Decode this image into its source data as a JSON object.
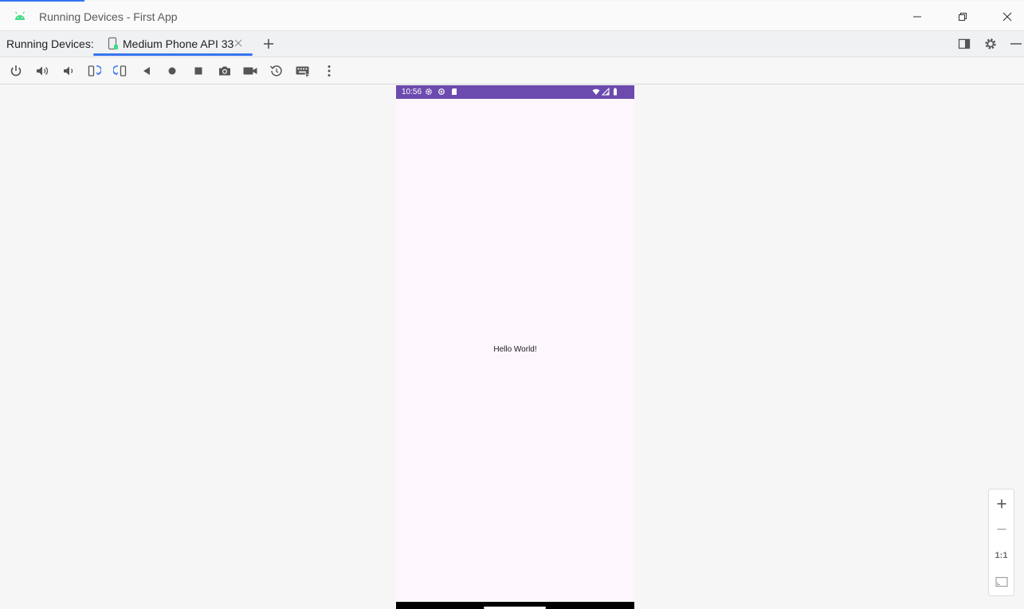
{
  "window": {
    "title": "Running Devices - First App",
    "controls": [
      "minimize-icon",
      "restore-icon",
      "close-icon"
    ]
  },
  "tabbar": {
    "label": "Running Devices:",
    "tabs": [
      {
        "label": "Medium Phone API 33",
        "icon": "device-icon",
        "active": true
      }
    ],
    "add_icon": "plus-icon",
    "right_icons": [
      "layout-icon",
      "gear-icon",
      "minimize-panel-icon"
    ]
  },
  "toolbar": {
    "icons": [
      "power-icon",
      "volume-up-icon",
      "volume-down-icon",
      "rotate-left-icon",
      "rotate-right-icon",
      "back-icon",
      "home-icon",
      "overview-icon",
      "screenshot-icon",
      "screen-record-icon",
      "snapshot-icon",
      "virtual-keyboard-icon",
      "more-options-icon"
    ]
  },
  "device": {
    "status_bar": {
      "time": "10:56",
      "left_icons": [
        "settings-icon",
        "location-icon",
        "sd-card-icon"
      ],
      "right_icons": [
        "wifi-icon",
        "signal-icon",
        "battery-icon"
      ],
      "color": "#6c4bae"
    },
    "content": {
      "text": "Hello World!"
    },
    "background": "#fdf7fd"
  },
  "zoom": {
    "icons": [
      "zoom-in-icon",
      "zoom-out-icon",
      "actual-size-icon",
      "fit-screen-icon"
    ],
    "actual_size_label": "1:1"
  },
  "colors": {
    "accent": "#3574f0",
    "android_green": "#3ddc84"
  }
}
